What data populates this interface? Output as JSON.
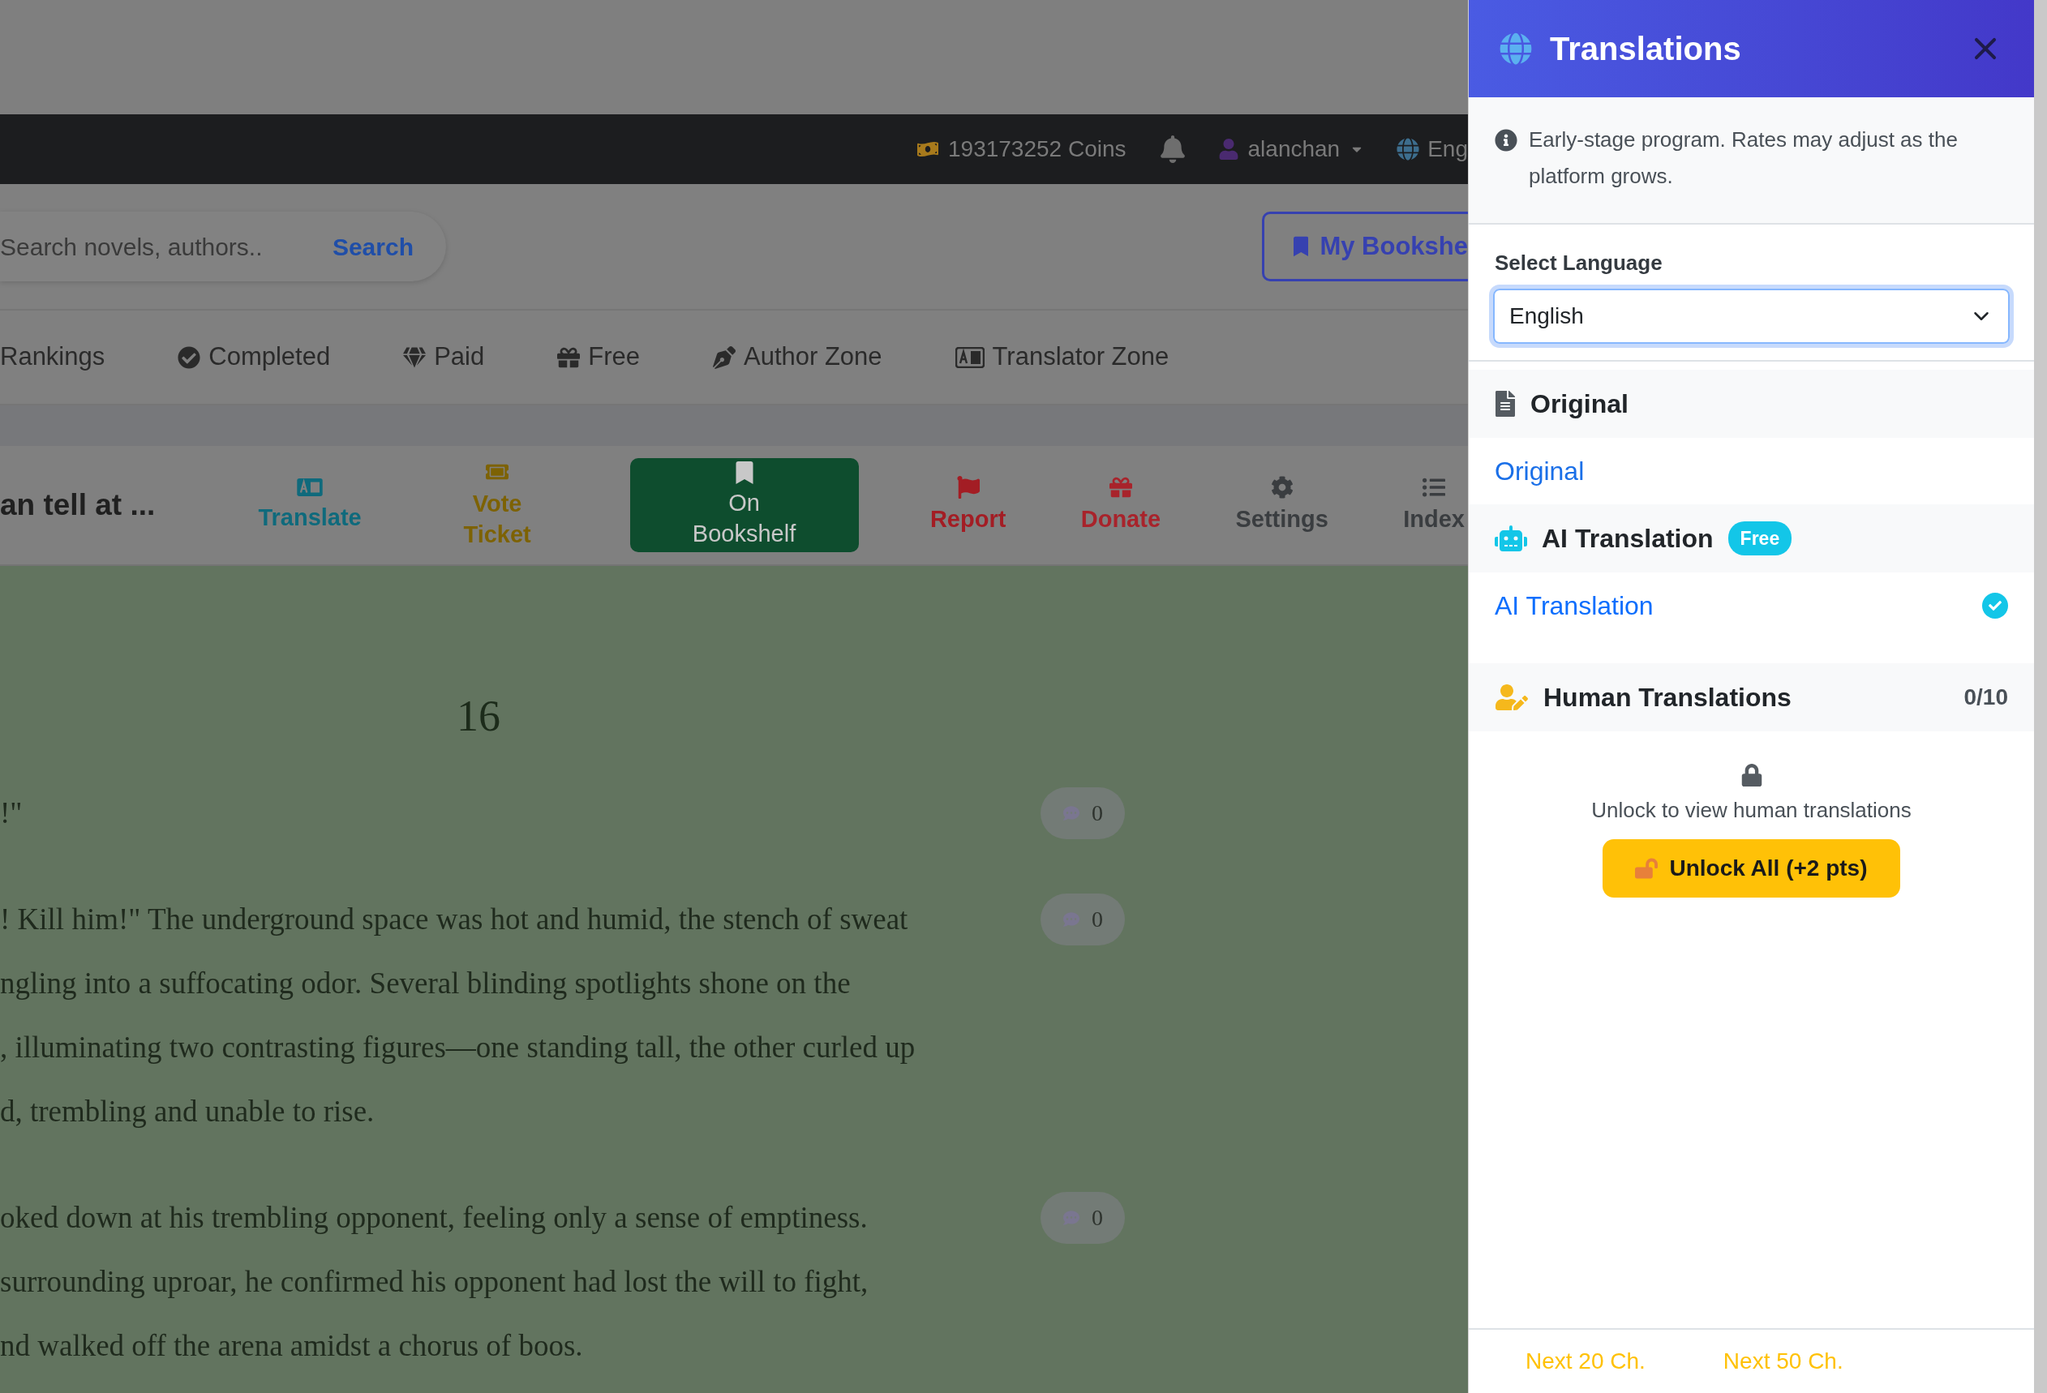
{
  "top_bar": {
    "coins": "193173252 Coins",
    "username": "alanchan",
    "language": "Eng"
  },
  "search": {
    "placeholder": "Search novels, authors..",
    "button": "Search"
  },
  "my_bookshelf": "My Bookshe",
  "nav_links": [
    {
      "kind": "rankings",
      "label": "Rankings"
    },
    {
      "kind": "completed",
      "label": "Completed"
    },
    {
      "kind": "paid",
      "label": "Paid"
    },
    {
      "kind": "free",
      "label": "Free"
    },
    {
      "kind": "author",
      "label": "Author Zone"
    },
    {
      "kind": "translator",
      "label": "Translator Zone"
    }
  ],
  "chapter_toolbar": {
    "title": "an tell at ...",
    "actions": [
      {
        "kind": "translate",
        "label": "Translate",
        "color": "#0f6a7c"
      },
      {
        "kind": "vote",
        "label": "Vote Ticket",
        "color": "#7d6204"
      },
      {
        "kind": "bookshelf",
        "label": "On Bookshelf",
        "selected": true
      },
      {
        "kind": "report",
        "label": "Report",
        "color": "#a31d24"
      },
      {
        "kind": "donate",
        "label": "Donate",
        "color": "#a8232b"
      },
      {
        "kind": "settings",
        "label": "Settings",
        "color": "#3a3d40"
      },
      {
        "kind": "index",
        "label": "Index",
        "color": "#3a3d40"
      }
    ]
  },
  "chapter": {
    "heading": "16",
    "paragraphs": [
      {
        "lines": [
          "!\""
        ],
        "comments": "0"
      },
      {
        "lines": [
          "! Kill him!\" The underground space was hot and humid, the stench of sweat",
          "ngling into a suffocating odor. Several blinding spotlights shone on the",
          ", illuminating two contrasting figures—one standing tall, the other curled up",
          "d, trembling and unable to rise."
        ],
        "comments": "0"
      },
      {
        "lines": [
          "oked down at his trembling opponent, feeling only a sense of emptiness.",
          "surrounding uproar, he confirmed his opponent had lost the will to fight,",
          "nd walked off the arena amidst a chorus of boos."
        ],
        "comments": "0"
      }
    ]
  },
  "panel": {
    "title": "Translations",
    "notice": "Early-stage program. Rates may adjust as the platform grows.",
    "language_label": "Select Language",
    "language": "English",
    "sections": [
      {
        "kind": "original",
        "title": "Original",
        "options": [
          {
            "label": "Original",
            "selected": false
          }
        ]
      },
      {
        "kind": "ai",
        "title": "AI Translation",
        "badge": "Free",
        "options": [
          {
            "label": "AI Translation",
            "selected": true
          }
        ]
      },
      {
        "kind": "human",
        "title": "Human Translations",
        "count": "0/10",
        "locked": {
          "message": "Unlock to view human translations",
          "button": "Unlock All (+2 pts)"
        }
      }
    ],
    "footer_links": [
      "Next 20 Ch.",
      "Next 50 Ch."
    ]
  }
}
